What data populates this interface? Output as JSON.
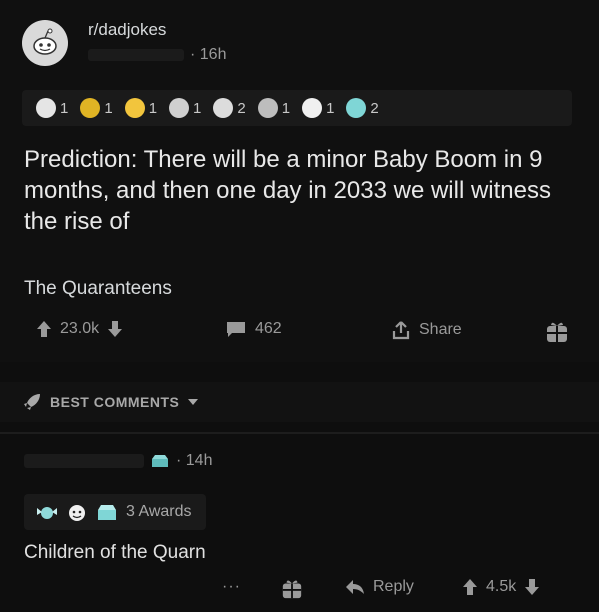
{
  "post": {
    "subreddit": "r/dadjokes",
    "time": "· 16h",
    "awards": [
      {
        "icon": "alien-award-icon",
        "count": "1",
        "color": "#e5e5e5"
      },
      {
        "icon": "gold-star-award-icon",
        "count": "1",
        "color": "#e0b424"
      },
      {
        "icon": "gold-medal-award-icon",
        "count": "1",
        "color": "#f2c53d"
      },
      {
        "icon": "splash-award-icon",
        "count": "1",
        "color": "#cfcfcf"
      },
      {
        "icon": "face-award-icon",
        "count": "2",
        "color": "#dcdcdc"
      },
      {
        "icon": "silver-s-award-icon",
        "count": "1",
        "color": "#bdbdbd"
      },
      {
        "icon": "wholesome-award-icon",
        "count": "1",
        "color": "#f0f0f0"
      },
      {
        "icon": "helpful-award-icon",
        "count": "2",
        "color": "#7fd6d6"
      }
    ],
    "title": "Prediction: There will be a minor Baby Boom in 9 months, and then one day in 2033 we will witness the rise of",
    "body": "The Quaranteens",
    "upvotes": "23.0k",
    "comments": "462",
    "share_label": "Share"
  },
  "sort": {
    "label": "BEST COMMENTS"
  },
  "comment": {
    "time": "· 14h",
    "awards_label": "3 Awards",
    "text": "Children of the Quarn",
    "more": "···",
    "reply_label": "Reply",
    "score": "4.5k"
  }
}
